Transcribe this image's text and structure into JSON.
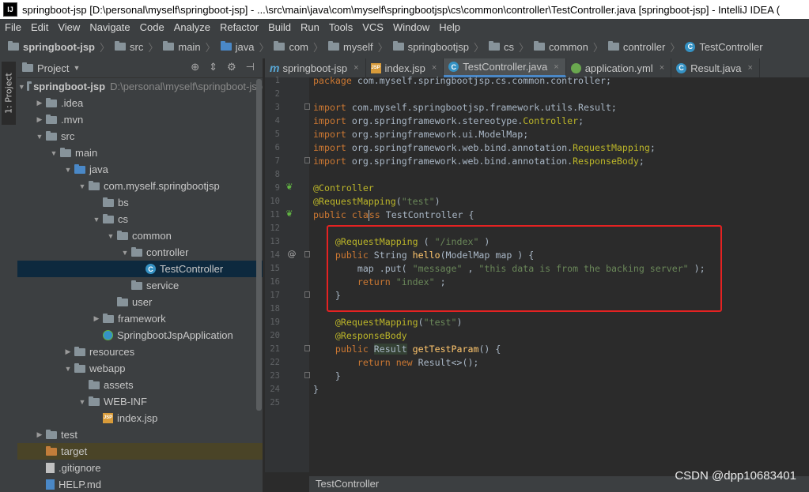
{
  "window": {
    "title": "springboot-jsp [D:\\personal\\myself\\springboot-jsp] - ...\\src\\main\\java\\com\\myself\\springbootjsp\\cs\\common\\controller\\TestController.java [springboot-jsp] - IntelliJ IDEA (",
    "app_icon_text": "IJ"
  },
  "menu": [
    "File",
    "Edit",
    "View",
    "Navigate",
    "Code",
    "Analyze",
    "Refactor",
    "Build",
    "Run",
    "Tools",
    "VCS",
    "Window",
    "Help"
  ],
  "breadcrumb": [
    "springboot-jsp",
    "src",
    "main",
    "java",
    "com",
    "myself",
    "springbootjsp",
    "cs",
    "common",
    "controller",
    "TestController"
  ],
  "tool_strip": {
    "project_tab": "1: Project"
  },
  "project_panel": {
    "title": "Project",
    "tree": [
      {
        "label": "springboot-jsp",
        "extra": "D:\\personal\\myself\\springboot-jsp",
        "indent": 0,
        "arrow": "down",
        "icon": "folder",
        "bold": true
      },
      {
        "label": ".idea",
        "indent": 1,
        "arrow": "right",
        "icon": "folder"
      },
      {
        "label": ".mvn",
        "indent": 1,
        "arrow": "right",
        "icon": "folder"
      },
      {
        "label": "src",
        "indent": 1,
        "arrow": "down",
        "icon": "folder"
      },
      {
        "label": "main",
        "indent": 2,
        "arrow": "down",
        "icon": "folder"
      },
      {
        "label": "java",
        "indent": 3,
        "arrow": "down",
        "icon": "folder-blue"
      },
      {
        "label": "com.myself.springbootjsp",
        "indent": 4,
        "arrow": "down",
        "icon": "folder"
      },
      {
        "label": "bs",
        "indent": 5,
        "arrow": "",
        "icon": "folder"
      },
      {
        "label": "cs",
        "indent": 5,
        "arrow": "down",
        "icon": "folder"
      },
      {
        "label": "common",
        "indent": 6,
        "arrow": "down",
        "icon": "folder"
      },
      {
        "label": "controller",
        "indent": 7,
        "arrow": "down",
        "icon": "folder"
      },
      {
        "label": "TestController",
        "indent": 8,
        "arrow": "",
        "icon": "class",
        "selected": true
      },
      {
        "label": "service",
        "indent": 7,
        "arrow": "",
        "icon": "folder"
      },
      {
        "label": "user",
        "indent": 6,
        "arrow": "",
        "icon": "folder"
      },
      {
        "label": "framework",
        "indent": 5,
        "arrow": "right",
        "icon": "folder"
      },
      {
        "label": "SpringbootJspApplication",
        "indent": 5,
        "arrow": "",
        "icon": "app"
      },
      {
        "label": "resources",
        "indent": 3,
        "arrow": "right",
        "icon": "folder"
      },
      {
        "label": "webapp",
        "indent": 3,
        "arrow": "down",
        "icon": "folder"
      },
      {
        "label": "assets",
        "indent": 4,
        "arrow": "",
        "icon": "folder"
      },
      {
        "label": "WEB-INF",
        "indent": 4,
        "arrow": "down",
        "icon": "folder"
      },
      {
        "label": "index.jsp",
        "indent": 5,
        "arrow": "",
        "icon": "jsp"
      },
      {
        "label": "test",
        "indent": 1,
        "arrow": "right",
        "icon": "folder"
      },
      {
        "label": "target",
        "indent": 1,
        "arrow": "",
        "icon": "folder-orange",
        "target": true
      },
      {
        "label": ".gitignore",
        "indent": 1,
        "arrow": "",
        "icon": "file"
      },
      {
        "label": "HELP.md",
        "indent": 1,
        "arrow": "",
        "icon": "md"
      }
    ]
  },
  "tabs": [
    {
      "label": "springboot-jsp",
      "icon": "m"
    },
    {
      "label": "index.jsp",
      "icon": "jsp"
    },
    {
      "label": "TestController.java",
      "icon": "class",
      "active": true
    },
    {
      "label": "application.yml",
      "icon": "yml"
    },
    {
      "label": "Result.java",
      "icon": "class"
    }
  ],
  "editor": {
    "line_numbers": [
      "1",
      "2",
      "3",
      "4",
      "5",
      "6",
      "7",
      "8",
      "9",
      "10",
      "11",
      "12",
      "13",
      "14",
      "15",
      "16",
      "17",
      "18",
      "19",
      "20",
      "21",
      "22",
      "23",
      "24",
      "25"
    ],
    "status_label": "TestController"
  },
  "watermark": "CSDN @dpp10683401",
  "colors": {
    "keyword": "#cc7832",
    "annotation": "#bbb529",
    "string": "#6a8759",
    "method": "#ffc66d",
    "highlight_box": "#e52222"
  }
}
